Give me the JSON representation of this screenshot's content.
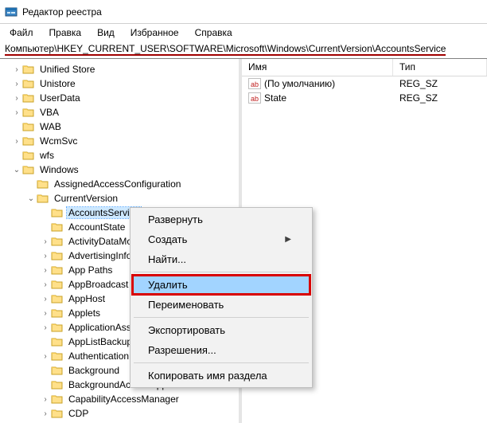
{
  "title": "Редактор реестра",
  "menu": [
    "Файл",
    "Правка",
    "Вид",
    "Избранное",
    "Справка"
  ],
  "path": "Компьютер\\HKEY_CURRENT_USER\\SOFTWARE\\Microsoft\\Windows\\CurrentVersion\\AccountsService",
  "tree": [
    {
      "indent": 14,
      "chevron": ">",
      "label": "Unified Store"
    },
    {
      "indent": 14,
      "chevron": ">",
      "label": "Unistore"
    },
    {
      "indent": 14,
      "chevron": ">",
      "label": "UserData"
    },
    {
      "indent": 14,
      "chevron": ">",
      "label": "VBA"
    },
    {
      "indent": 14,
      "chevron": "",
      "label": "WAB"
    },
    {
      "indent": 14,
      "chevron": ">",
      "label": "WcmSvc"
    },
    {
      "indent": 14,
      "chevron": "",
      "label": "wfs"
    },
    {
      "indent": 14,
      "chevron": "v",
      "label": "Windows"
    },
    {
      "indent": 32,
      "chevron": "",
      "label": "AssignedAccessConfiguration"
    },
    {
      "indent": 32,
      "chevron": "v",
      "label": "CurrentVersion"
    },
    {
      "indent": 50,
      "chevron": "",
      "label": "AccountsService",
      "selected": true
    },
    {
      "indent": 50,
      "chevron": "",
      "label": "AccountState"
    },
    {
      "indent": 50,
      "chevron": ">",
      "label": "ActivityDataMo"
    },
    {
      "indent": 50,
      "chevron": ">",
      "label": "AdvertisingInfo"
    },
    {
      "indent": 50,
      "chevron": ">",
      "label": "App Paths"
    },
    {
      "indent": 50,
      "chevron": ">",
      "label": "AppBroadcast"
    },
    {
      "indent": 50,
      "chevron": ">",
      "label": "AppHost"
    },
    {
      "indent": 50,
      "chevron": ">",
      "label": "Applets"
    },
    {
      "indent": 50,
      "chevron": ">",
      "label": "ApplicationAss"
    },
    {
      "indent": 50,
      "chevron": "",
      "label": "AppListBackup"
    },
    {
      "indent": 50,
      "chevron": ">",
      "label": "Authentication"
    },
    {
      "indent": 50,
      "chevron": "",
      "label": "Background"
    },
    {
      "indent": 50,
      "chevron": "",
      "label": "BackgroundAccessApplications"
    },
    {
      "indent": 50,
      "chevron": ">",
      "label": "CapabilityAccessManager"
    },
    {
      "indent": 50,
      "chevron": ">",
      "label": "CDP"
    }
  ],
  "list_columns": {
    "name": "Имя",
    "type": "Тип"
  },
  "list_rows": [
    {
      "name": "(По умолчанию)",
      "type": "REG_SZ"
    },
    {
      "name": "State",
      "type": "REG_SZ"
    }
  ],
  "context_menu": {
    "expand": "Развернуть",
    "create": "Создать",
    "find": "Найти...",
    "delete": "Удалить",
    "rename": "Переименовать",
    "export": "Экспортировать",
    "permissions": "Разрешения...",
    "copy_name": "Копировать имя раздела"
  }
}
